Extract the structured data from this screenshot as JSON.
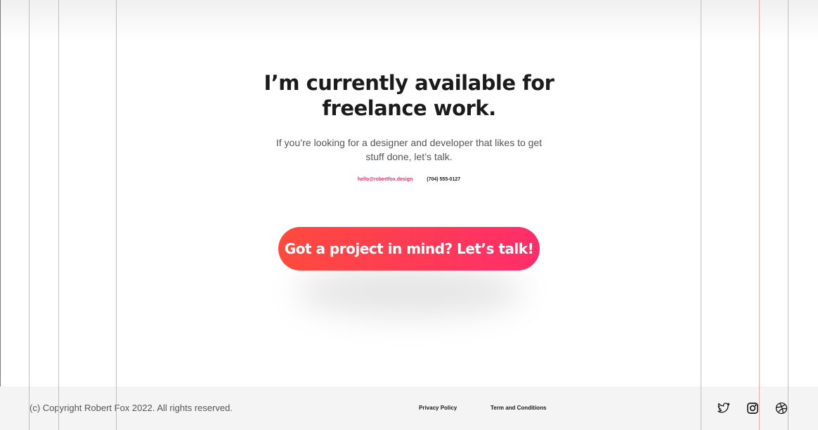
{
  "hero": {
    "headline_line1": "I’m currently available for",
    "headline_line2": "freelance work.",
    "subtext_line1": "If you’re looking for a designer and developer that likes to get",
    "subtext_line2": "stuff done, let’s talk.",
    "email": "hello@robertfox.design",
    "phone": "(704) 555-0127",
    "cta_label": "Got a project in mind? Let’s talk!"
  },
  "footer": {
    "copyright": "(c) Copyright Robert Fox 2022. All rights reserved.",
    "links": [
      {
        "label": "Privacy Policy"
      },
      {
        "label": "Term and Conditions"
      }
    ],
    "social": [
      "twitter-icon",
      "instagram-icon",
      "dribbble-icon"
    ]
  },
  "colors": {
    "accent": "#f0266c",
    "cta_start": "#ff4a3d",
    "cta_end": "#ff2d6b",
    "footer_bg": "#f4f4f4",
    "guide": "#f2a9a2",
    "text_dark": "#1b1b1b",
    "text_muted": "#555555"
  }
}
